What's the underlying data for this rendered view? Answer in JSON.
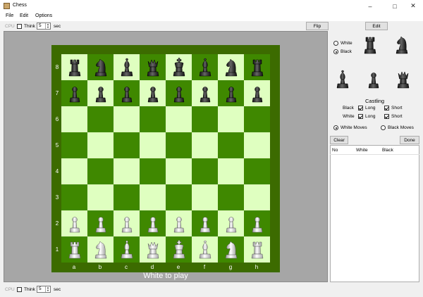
{
  "window": {
    "title": "Chess"
  },
  "menu": [
    "File",
    "Edit",
    "Options"
  ],
  "toolbar": {
    "cpu_label": "CPU",
    "think_label": "Think",
    "think_value": "5",
    "sec_label": "sec",
    "flip_label": "Flip",
    "edit_label": "Edit"
  },
  "board": {
    "ranks": [
      "8",
      "7",
      "6",
      "5",
      "4",
      "3",
      "2",
      "1"
    ],
    "files": [
      "a",
      "b",
      "c",
      "d",
      "e",
      "f",
      "g",
      "h"
    ],
    "position": [
      [
        "bR",
        "bN",
        "bB",
        "bQ",
        "bK",
        "bB",
        "bN",
        "bR"
      ],
      [
        "bP",
        "bP",
        "bP",
        "bP",
        "bP",
        "bP",
        "bP",
        "bP"
      ],
      [
        "",
        "",
        "",
        "",
        "",
        "",
        "",
        ""
      ],
      [
        "",
        "",
        "",
        "",
        "",
        "",
        "",
        ""
      ],
      [
        "",
        "",
        "",
        "",
        "",
        "",
        "",
        ""
      ],
      [
        "",
        "",
        "",
        "",
        "",
        "",
        "",
        ""
      ],
      [
        "wP",
        "wP",
        "wP",
        "wP",
        "wP",
        "wP",
        "wP",
        "wP"
      ],
      [
        "wR",
        "wN",
        "wB",
        "wQ",
        "wK",
        "wB",
        "wN",
        "wR"
      ]
    ],
    "status": "White to play"
  },
  "editor": {
    "color_white": "White",
    "color_black": "Black",
    "selected_color": "Black",
    "castling_title": "Castling",
    "castling_black": "Black",
    "castling_white": "White",
    "long": "Long",
    "short": "Short",
    "white_moves": "White Moves",
    "black_moves": "Black Moves",
    "side_to_move": "White Moves",
    "clear_label": "Clear",
    "done_label": "Done"
  },
  "moves_table": {
    "headers": [
      "No",
      "White",
      "Black"
    ]
  },
  "bottom": {
    "cpu_label": "CPU",
    "think_label": "Think",
    "think_value": "5",
    "sec_label": "sec"
  },
  "colors": {
    "dark_square": "#3f8800",
    "light_square": "#dfffc0",
    "frame": "#3c6b00"
  }
}
